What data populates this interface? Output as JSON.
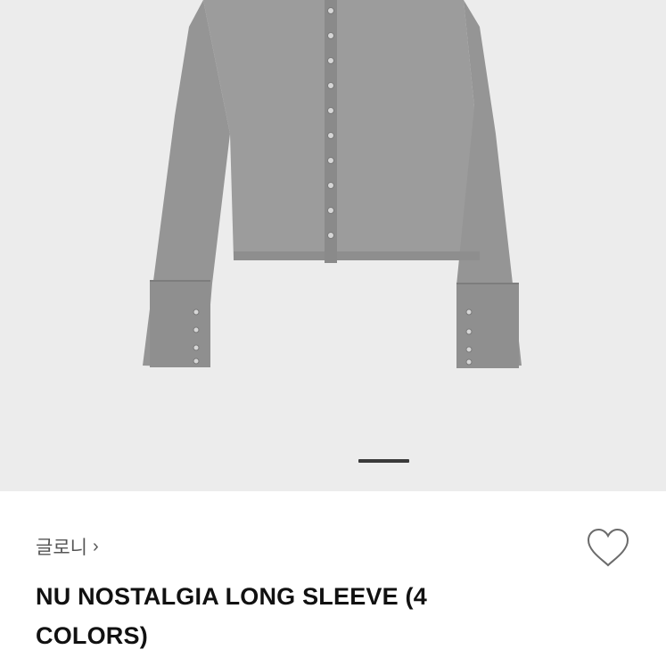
{
  "gallery": {
    "image_alt": "grey long sleeve cardigan with snap buttons",
    "active_slide": 1
  },
  "product": {
    "brand": "글로니",
    "brand_chevron": "›",
    "title": "NU NOSTALGIA LONG SLEEVE (4 COLORS)",
    "wishlist_icon": "heart-outline-icon"
  },
  "colors": {
    "background": "#ececec",
    "garment": "#9a9a9a",
    "text_primary": "#111111",
    "text_secondary": "#555555"
  }
}
